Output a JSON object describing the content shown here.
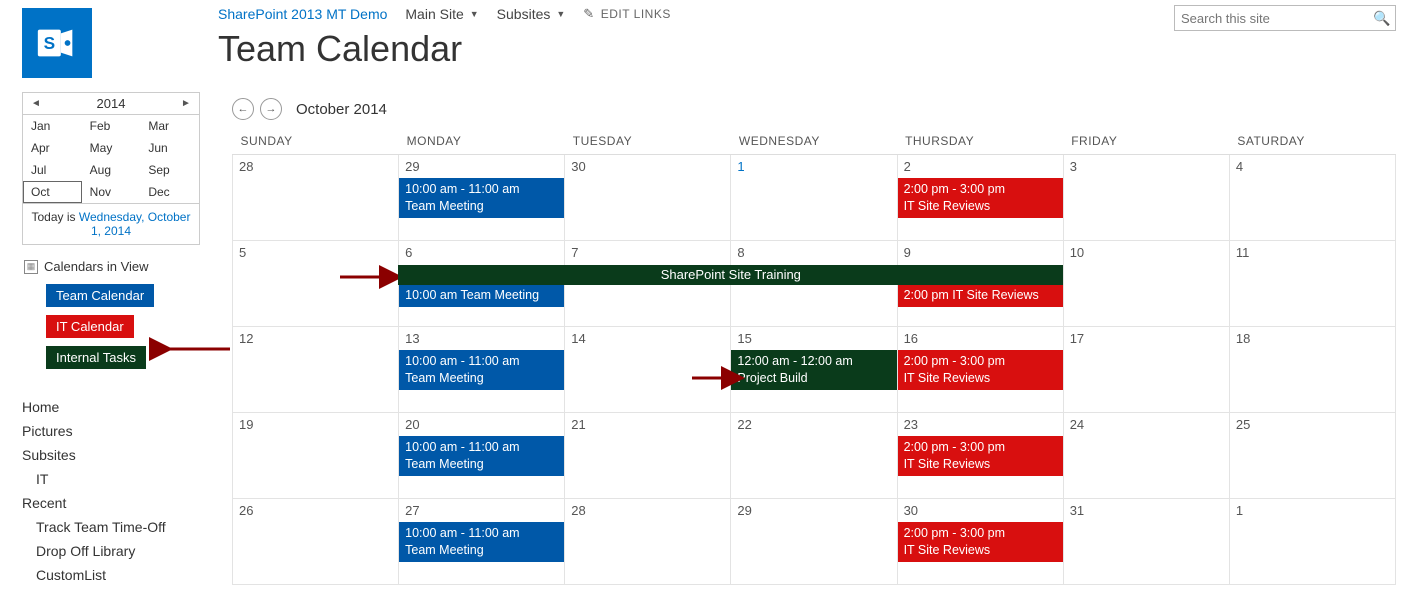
{
  "topnav": {
    "site_link": "SharePoint 2013 MT Demo",
    "main_site": "Main Site",
    "subsites": "Subsites",
    "edit_links": "EDIT LINKS"
  },
  "search": {
    "placeholder": "Search this site"
  },
  "page_title": "Team Calendar",
  "mini_cal": {
    "year": "2014",
    "months": [
      "Jan",
      "Feb",
      "Mar",
      "Apr",
      "May",
      "Jun",
      "Jul",
      "Aug",
      "Sep",
      "Oct",
      "Nov",
      "Dec"
    ],
    "selected": "Oct",
    "today_prefix": "Today is ",
    "today_date": "Wednesday, October 1, 2014"
  },
  "civ": {
    "heading": "Calendars in View",
    "items": [
      {
        "label": "Team Calendar",
        "cls": "tag-blue"
      },
      {
        "label": "IT Calendar",
        "cls": "tag-red"
      },
      {
        "label": "Internal Tasks",
        "cls": "tag-green"
      }
    ]
  },
  "quicklaunch": [
    {
      "label": "Home",
      "sub": false
    },
    {
      "label": "Pictures",
      "sub": false
    },
    {
      "label": "Subsites",
      "sub": false
    },
    {
      "label": "IT",
      "sub": true
    },
    {
      "label": "Recent",
      "sub": false
    },
    {
      "label": "Track Team Time-Off",
      "sub": true
    },
    {
      "label": "Drop Off Library",
      "sub": true
    },
    {
      "label": "CustomList",
      "sub": true
    }
  ],
  "calendar": {
    "title": "October 2014",
    "day_headers": [
      "SUNDAY",
      "MONDAY",
      "TUESDAY",
      "WEDNESDAY",
      "THURSDAY",
      "FRIDAY",
      "SATURDAY"
    ],
    "weeks": [
      [
        {
          "n": "28"
        },
        {
          "n": "29",
          "ev": [
            {
              "c": "blue",
              "t1": "10:00 am - 11:00 am",
              "t2": "Team Meeting"
            }
          ]
        },
        {
          "n": "30"
        },
        {
          "n": "1",
          "link": true
        },
        {
          "n": "2",
          "ev": [
            {
              "c": "red",
              "t1": "2:00 pm - 3:00 pm",
              "t2": "IT Site Reviews"
            }
          ]
        },
        {
          "n": "3"
        },
        {
          "n": "4"
        }
      ],
      [
        {
          "n": "5"
        },
        {
          "n": "6",
          "ev2": [
            {
              "c": "blue",
              "t": "10:00 am Team Meeting"
            }
          ]
        },
        {
          "n": "7"
        },
        {
          "n": "8"
        },
        {
          "n": "9",
          "ev2": [
            {
              "c": "red",
              "t": "2:00 pm IT Site Reviews"
            }
          ]
        },
        {
          "n": "10"
        },
        {
          "n": "11"
        }
      ],
      [
        {
          "n": "12"
        },
        {
          "n": "13",
          "ev": [
            {
              "c": "blue",
              "t1": "10:00 am - 11:00 am",
              "t2": "Team Meeting"
            }
          ]
        },
        {
          "n": "14"
        },
        {
          "n": "15",
          "ev": [
            {
              "c": "green",
              "t1": "12:00 am - 12:00 am",
              "t2": "Project Build"
            }
          ]
        },
        {
          "n": "16",
          "ev": [
            {
              "c": "red",
              "t1": "2:00 pm - 3:00 pm",
              "t2": "IT Site Reviews"
            }
          ]
        },
        {
          "n": "17"
        },
        {
          "n": "18"
        }
      ],
      [
        {
          "n": "19"
        },
        {
          "n": "20",
          "ev": [
            {
              "c": "blue",
              "t1": "10:00 am - 11:00 am",
              "t2": "Team Meeting"
            }
          ]
        },
        {
          "n": "21"
        },
        {
          "n": "22"
        },
        {
          "n": "23",
          "ev": [
            {
              "c": "red",
              "t1": "2:00 pm - 3:00 pm",
              "t2": "IT Site Reviews"
            }
          ]
        },
        {
          "n": "24"
        },
        {
          "n": "25"
        }
      ],
      [
        {
          "n": "26"
        },
        {
          "n": "27",
          "ev": [
            {
              "c": "blue",
              "t1": "10:00 am - 11:00 am",
              "t2": "Team Meeting"
            }
          ]
        },
        {
          "n": "28"
        },
        {
          "n": "29"
        },
        {
          "n": "30",
          "ev": [
            {
              "c": "red",
              "t1": "2:00 pm - 3:00 pm",
              "t2": "IT Site Reviews"
            }
          ]
        },
        {
          "n": "31"
        },
        {
          "n": "1"
        }
      ]
    ],
    "span_event": "SharePoint Site Training"
  }
}
